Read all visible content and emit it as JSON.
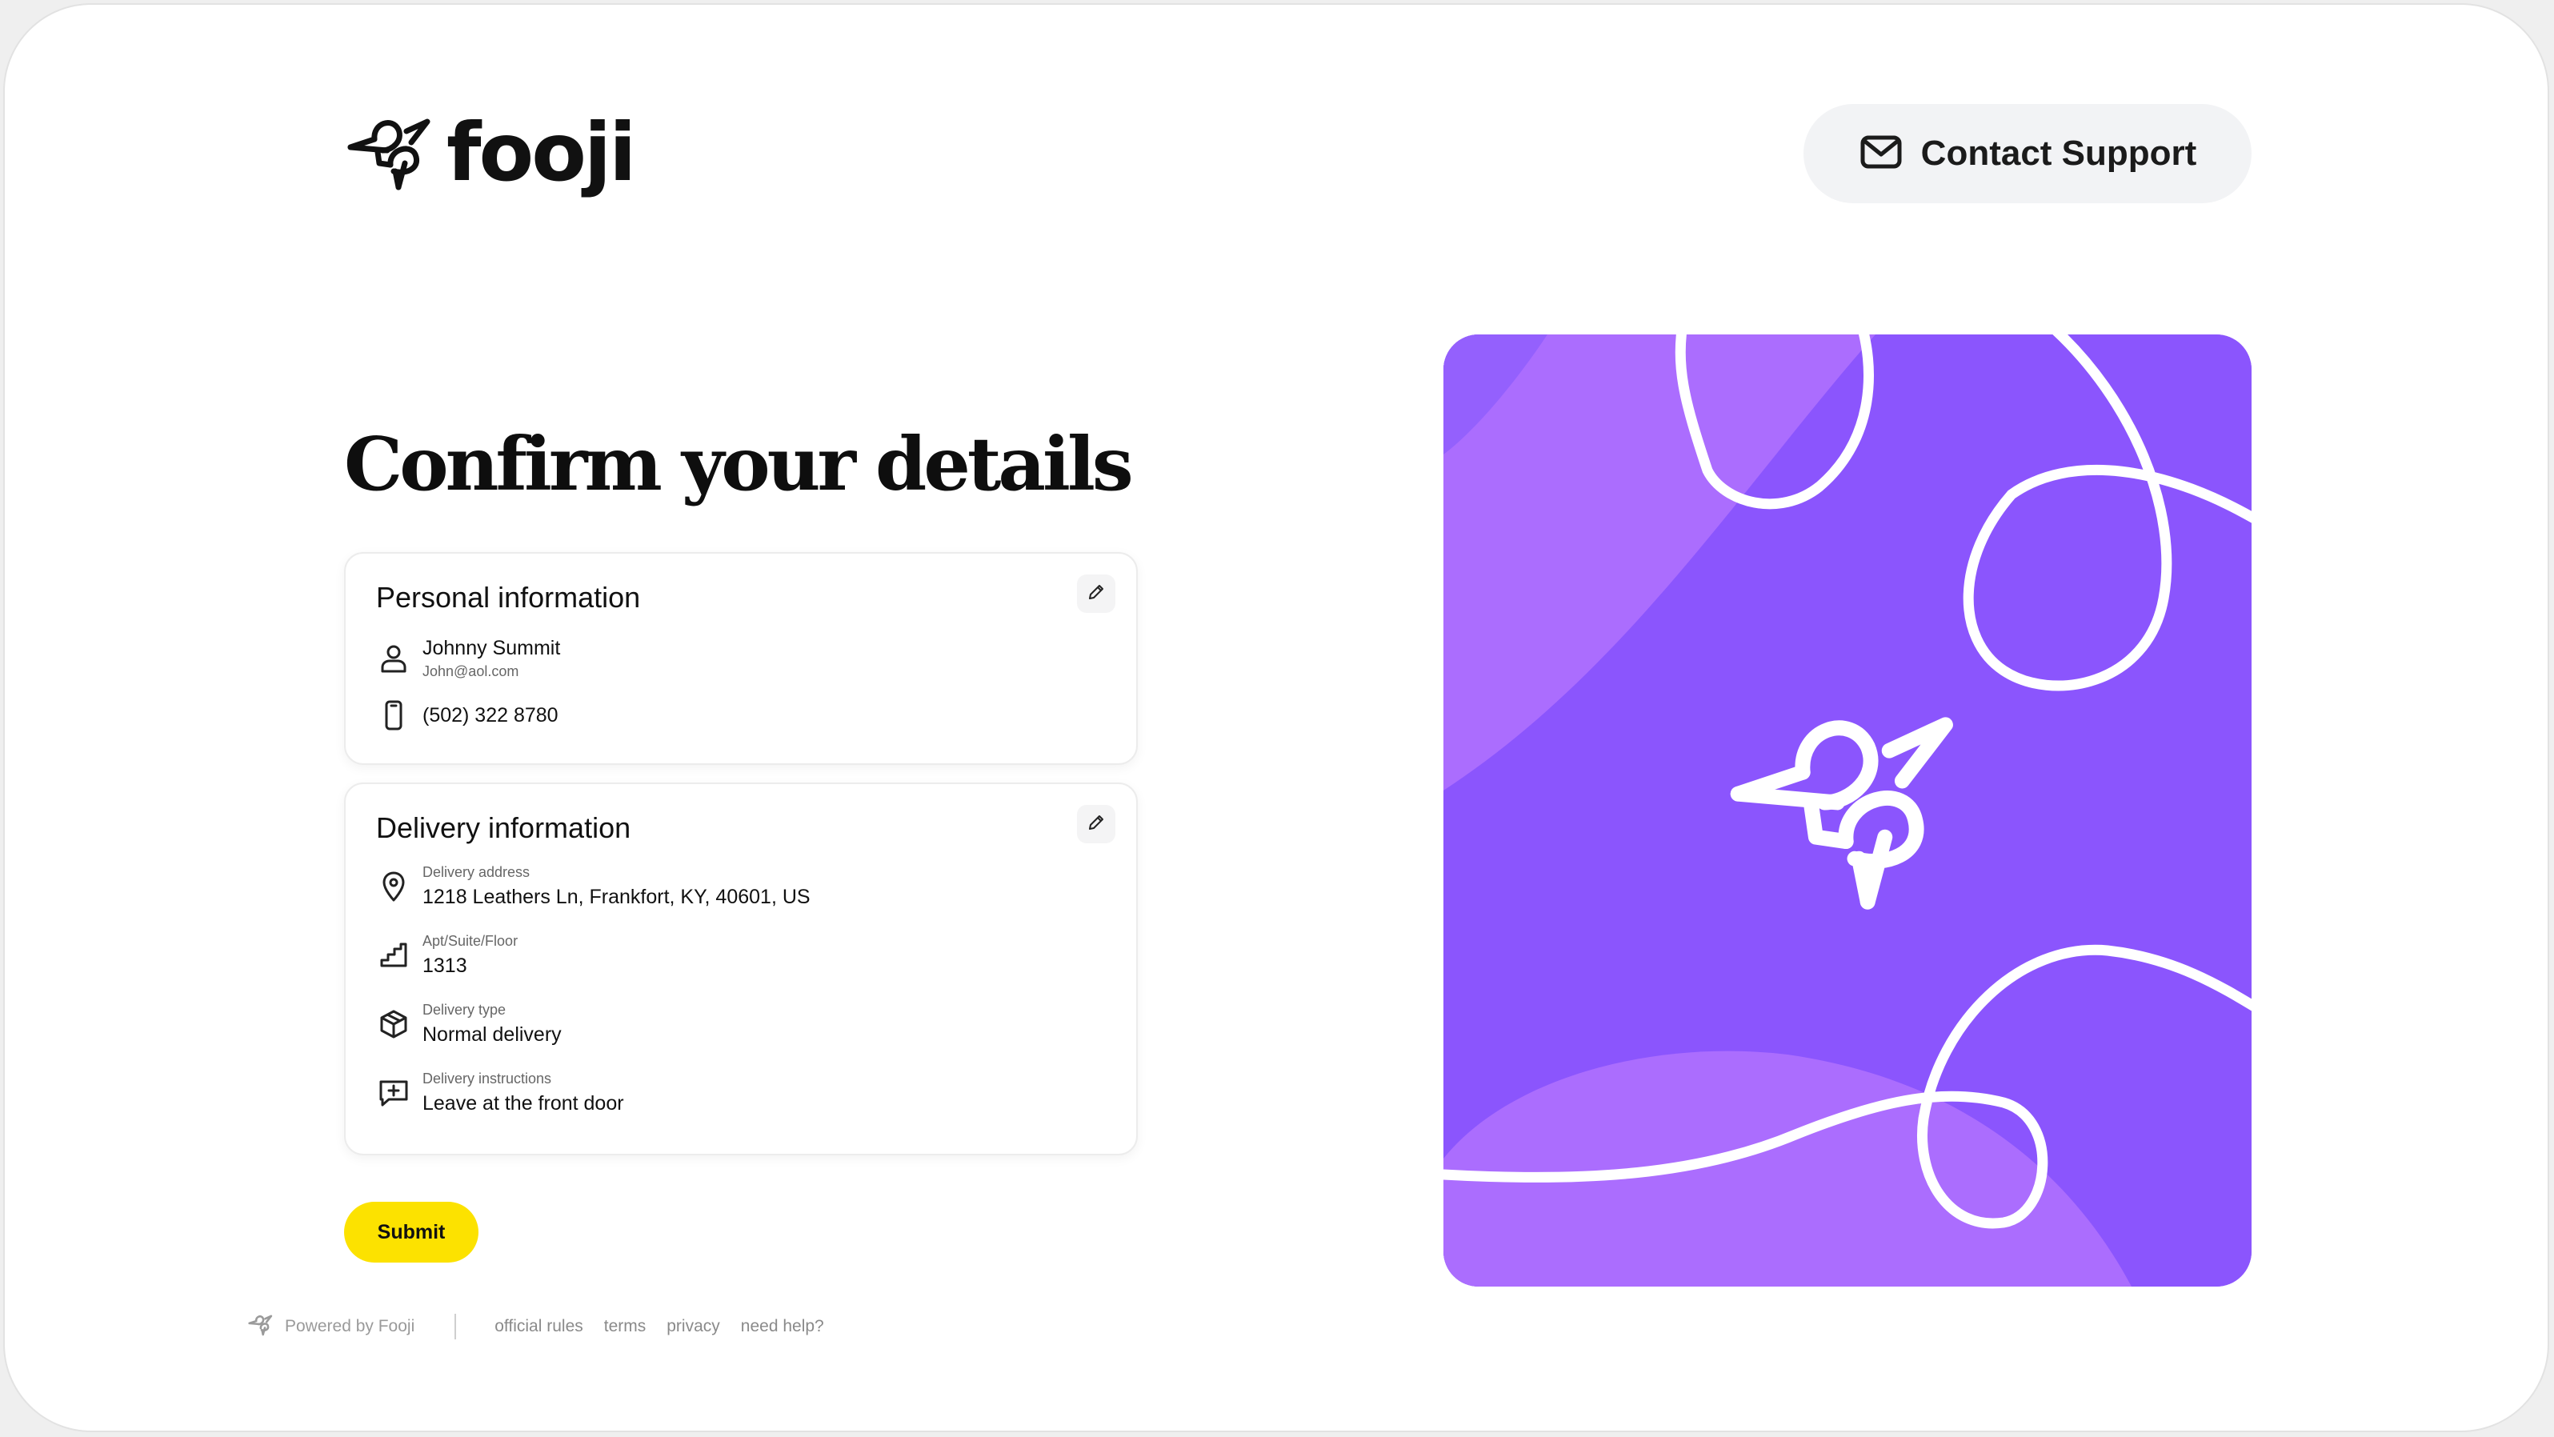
{
  "brand": {
    "name": "fooji"
  },
  "header": {
    "support_label": "Contact Support"
  },
  "page": {
    "title": "Confirm your details"
  },
  "personal": {
    "title": "Personal information",
    "name": "Johnny Summit",
    "email": "John@aol.com",
    "phone": "(502) 322 8780"
  },
  "delivery": {
    "title": "Delivery information",
    "address_label": "Delivery address",
    "address_value": "1218 Leathers Ln, Frankfort, KY, 40601, US",
    "apt_label": "Apt/Suite/Floor",
    "apt_value": "1313",
    "type_label": "Delivery type",
    "type_value": "Normal delivery",
    "instructions_label": "Delivery instructions",
    "instructions_value": "Leave at the front door"
  },
  "actions": {
    "submit_label": "Submit"
  },
  "footer": {
    "powered_by": "Powered by Fooji",
    "links": [
      "official rules",
      "terms",
      "privacy",
      "need help?"
    ]
  },
  "colors": {
    "accent_yellow": "#fce200",
    "hero_purple": "#8b55fd",
    "hero_purple_light": "#ab6dfe"
  },
  "icons": {
    "logo": "fooji-bird-icon",
    "support": "mail-icon",
    "edit": "pencil-icon",
    "person": "user-icon",
    "phone": "phone-icon",
    "address": "map-pin-icon",
    "apt": "stairs-icon",
    "type": "package-icon",
    "instructions": "message-plus-icon"
  }
}
